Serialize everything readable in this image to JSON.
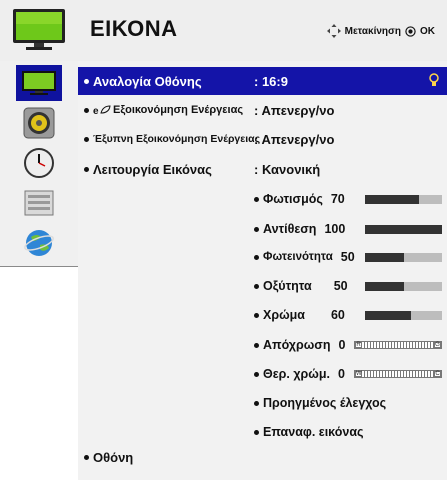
{
  "header": {
    "title": "ΕΙΚΟΝΑ",
    "hint_move": "Μετακίνηση",
    "hint_ok": "OK"
  },
  "menu": {
    "rows": [
      {
        "label": "Αναλογία Οθόνης",
        "value": ": 16:9"
      },
      {
        "label": "Εξοικονόμηση Ενέργειας",
        "value": ": Απενεργ/νο"
      },
      {
        "label": "Έξυπνη Εξοικονόμηση Ενέργειας",
        "value": ": Απενεργ/νο"
      },
      {
        "label": "Λειτουργία Εικόνας",
        "value": ": Κανονική"
      }
    ],
    "sliders": [
      {
        "label": "Φωτισμός",
        "value": "70",
        "level": 0.7
      },
      {
        "label": "Αντίθεση",
        "value": "100",
        "level": 1.0
      },
      {
        "label": "Φωτεινότητα",
        "value": "50",
        "level": 0.5
      },
      {
        "label": "Οξύτητα",
        "value": "50",
        "level": 0.5
      },
      {
        "label": "Χρώμα",
        "value": "60",
        "level": 0.6
      }
    ],
    "tints": [
      {
        "label": "Απόχρωση",
        "value": "0",
        "left": "R",
        "right": "G"
      },
      {
        "label": "Θερ. χρώμ.",
        "value": "0",
        "left": "W",
        "right": "C"
      }
    ],
    "extras": [
      {
        "label": "Προηγμένος έλεγχος"
      },
      {
        "label": "Επαναφ. εικόνας"
      }
    ],
    "last": {
      "label": "Οθόνη"
    }
  },
  "icons": {
    "tv": "tv-icon",
    "move": "move-arrows-icon",
    "ok": "ok-circle-icon",
    "sidebar": [
      "picture-tv-icon",
      "audio-speaker-icon",
      "clock-icon",
      "options-box-icon",
      "globe-network-icon"
    ],
    "eco_leaf": "eco-leaf-icon",
    "bulb": "lightbulb-icon"
  },
  "colors": {
    "selected": "#1414a8",
    "sidebar_active": "#0f129e",
    "bar_fill": "#333333",
    "bar_track": "#bdbdbd"
  }
}
